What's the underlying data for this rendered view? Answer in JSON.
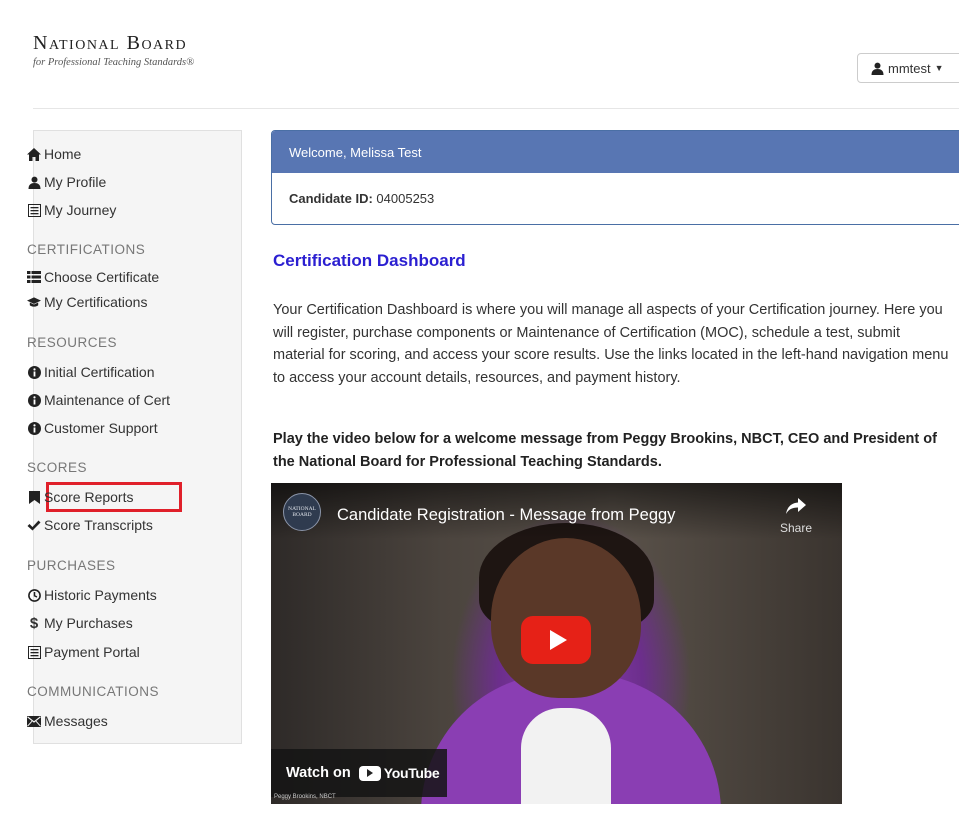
{
  "header": {
    "logo_main": "National Board",
    "logo_sub": "for Professional Teaching Standards®",
    "user_name": "mmtest"
  },
  "sidebar": {
    "top_items": [
      {
        "label": "Home",
        "icon": "home-icon"
      },
      {
        "label": "My Profile",
        "icon": "user-icon"
      },
      {
        "label": "My Journey",
        "icon": "list-alt-icon"
      }
    ],
    "sections": [
      {
        "heading": "CERTIFICATIONS",
        "items": [
          {
            "label": "Choose Certificate",
            "icon": "th-list-icon"
          },
          {
            "label": "My Certifications",
            "icon": "graduation-cap-icon"
          }
        ]
      },
      {
        "heading": "RESOURCES",
        "items": [
          {
            "label": "Initial Certification",
            "icon": "info-sign-icon"
          },
          {
            "label": "Maintenance of Cert",
            "icon": "info-sign-icon"
          },
          {
            "label": "Customer Support",
            "icon": "info-sign-icon"
          }
        ]
      },
      {
        "heading": "SCORES",
        "items": [
          {
            "label": "Score Reports",
            "icon": "bookmark-icon",
            "highlighted": true
          },
          {
            "label": "Score Transcripts",
            "icon": "checkmark-icon"
          }
        ]
      },
      {
        "heading": "PURCHASES",
        "items": [
          {
            "label": "Historic Payments",
            "icon": "clock-icon"
          },
          {
            "label": "My Purchases",
            "icon": "dollar-icon"
          },
          {
            "label": "Payment Portal",
            "icon": "list-alt-icon"
          }
        ]
      },
      {
        "heading": "COMMUNICATIONS",
        "items": [
          {
            "label": "Messages",
            "icon": "envelope-icon"
          }
        ]
      }
    ]
  },
  "welcome": {
    "greeting": "Welcome, Melissa Test",
    "candidate_label": "Candidate ID:",
    "candidate_id": "04005253"
  },
  "main": {
    "title": "Certification Dashboard",
    "intro": "Your Certification Dashboard is where you will manage all aspects of your Certification journey. Here you will register, purchase components or Maintenance of Certification (MOC), schedule a test, submit material for scoring, and access your score results. Use the links located in the left-hand navigation menu to access your account details, resources, and payment history.",
    "play_text": "Play the video below for a welcome message from Peggy Brookins, NBCT, CEO and President of the National Board for Professional Teaching Standards."
  },
  "video": {
    "title": "Candidate Registration - Message from Peggy",
    "share_label": "Share",
    "watch_on": "Watch on",
    "youtube": "YouTube",
    "caption": "Peggy Brookins, NBCT",
    "channel_logo_line1": "NATIONAL",
    "channel_logo_line2": "BOARD"
  },
  "colors": {
    "panel_header": "#5876b3",
    "title_blue": "#2b1fd1",
    "highlight_red": "#e0202a",
    "play_red": "#e62117"
  }
}
